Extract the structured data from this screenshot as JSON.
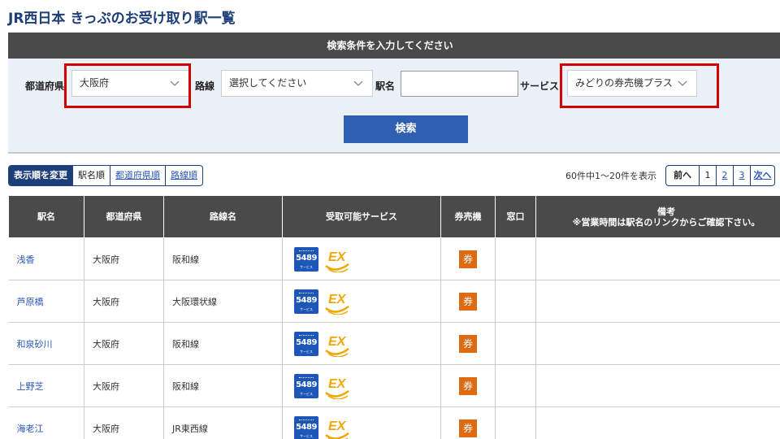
{
  "page": {
    "title": "JR西日本 きっぷのお受け取り駅一覧"
  },
  "search": {
    "header": "検索条件を入力してください",
    "prefecture_label": "都道府県",
    "prefecture_value": "大阪府",
    "line_label": "路線",
    "line_value": "選択してください",
    "station_label": "駅名",
    "station_value": "",
    "service_label": "サービス",
    "service_value": "みどりの券売機プラス",
    "submit_label": "検索"
  },
  "sort": {
    "label": "表示順を変更",
    "options": [
      "駅名順",
      "都道府県順",
      "路線順"
    ]
  },
  "pagination": {
    "summary": "60件中1～20件を表示",
    "prev_label": "前へ",
    "pages": [
      "1",
      "2",
      "3"
    ],
    "next_label": "次へ"
  },
  "table": {
    "headers": {
      "name": "駅名",
      "prefecture": "都道府県",
      "line": "路線名",
      "services": "受取可能サービス",
      "machine": "券売機",
      "counter": "窓口",
      "note_title": "備考",
      "note_sub": "※営業時間は駅名のリンクからご確認下さい。"
    },
    "rows": [
      {
        "name": "浅香",
        "prefecture": "大阪府",
        "line": "阪和線",
        "services": [
          "5489",
          "EX"
        ],
        "machine": "券",
        "counter": "",
        "note": ""
      },
      {
        "name": "芦原橋",
        "prefecture": "大阪府",
        "line": "大阪環状線",
        "services": [
          "5489",
          "EX"
        ],
        "machine": "券",
        "counter": "",
        "note": ""
      },
      {
        "name": "和泉砂川",
        "prefecture": "大阪府",
        "line": "阪和線",
        "services": [
          "5489",
          "EX"
        ],
        "machine": "券",
        "counter": "",
        "note": ""
      },
      {
        "name": "上野芝",
        "prefecture": "大阪府",
        "line": "阪和線",
        "services": [
          "5489",
          "EX"
        ],
        "machine": "券",
        "counter": "",
        "note": ""
      },
      {
        "name": "海老江",
        "prefecture": "大阪府",
        "line": "JR東西線",
        "services": [
          "5489",
          "EX"
        ],
        "machine": "券",
        "counter": "",
        "note": ""
      }
    ]
  },
  "badges": {
    "b5489_number": "5489",
    "b5489_sub": "サービス",
    "ex_text": "EX"
  },
  "colors": {
    "title": "#1d3e78",
    "header_bg": "#4a4a4a",
    "accent_blue": "#2e5fb0",
    "highlight_red": "#d40000",
    "ticket_orange": "#e06a12",
    "panel_bg": "#eaf1f9"
  }
}
